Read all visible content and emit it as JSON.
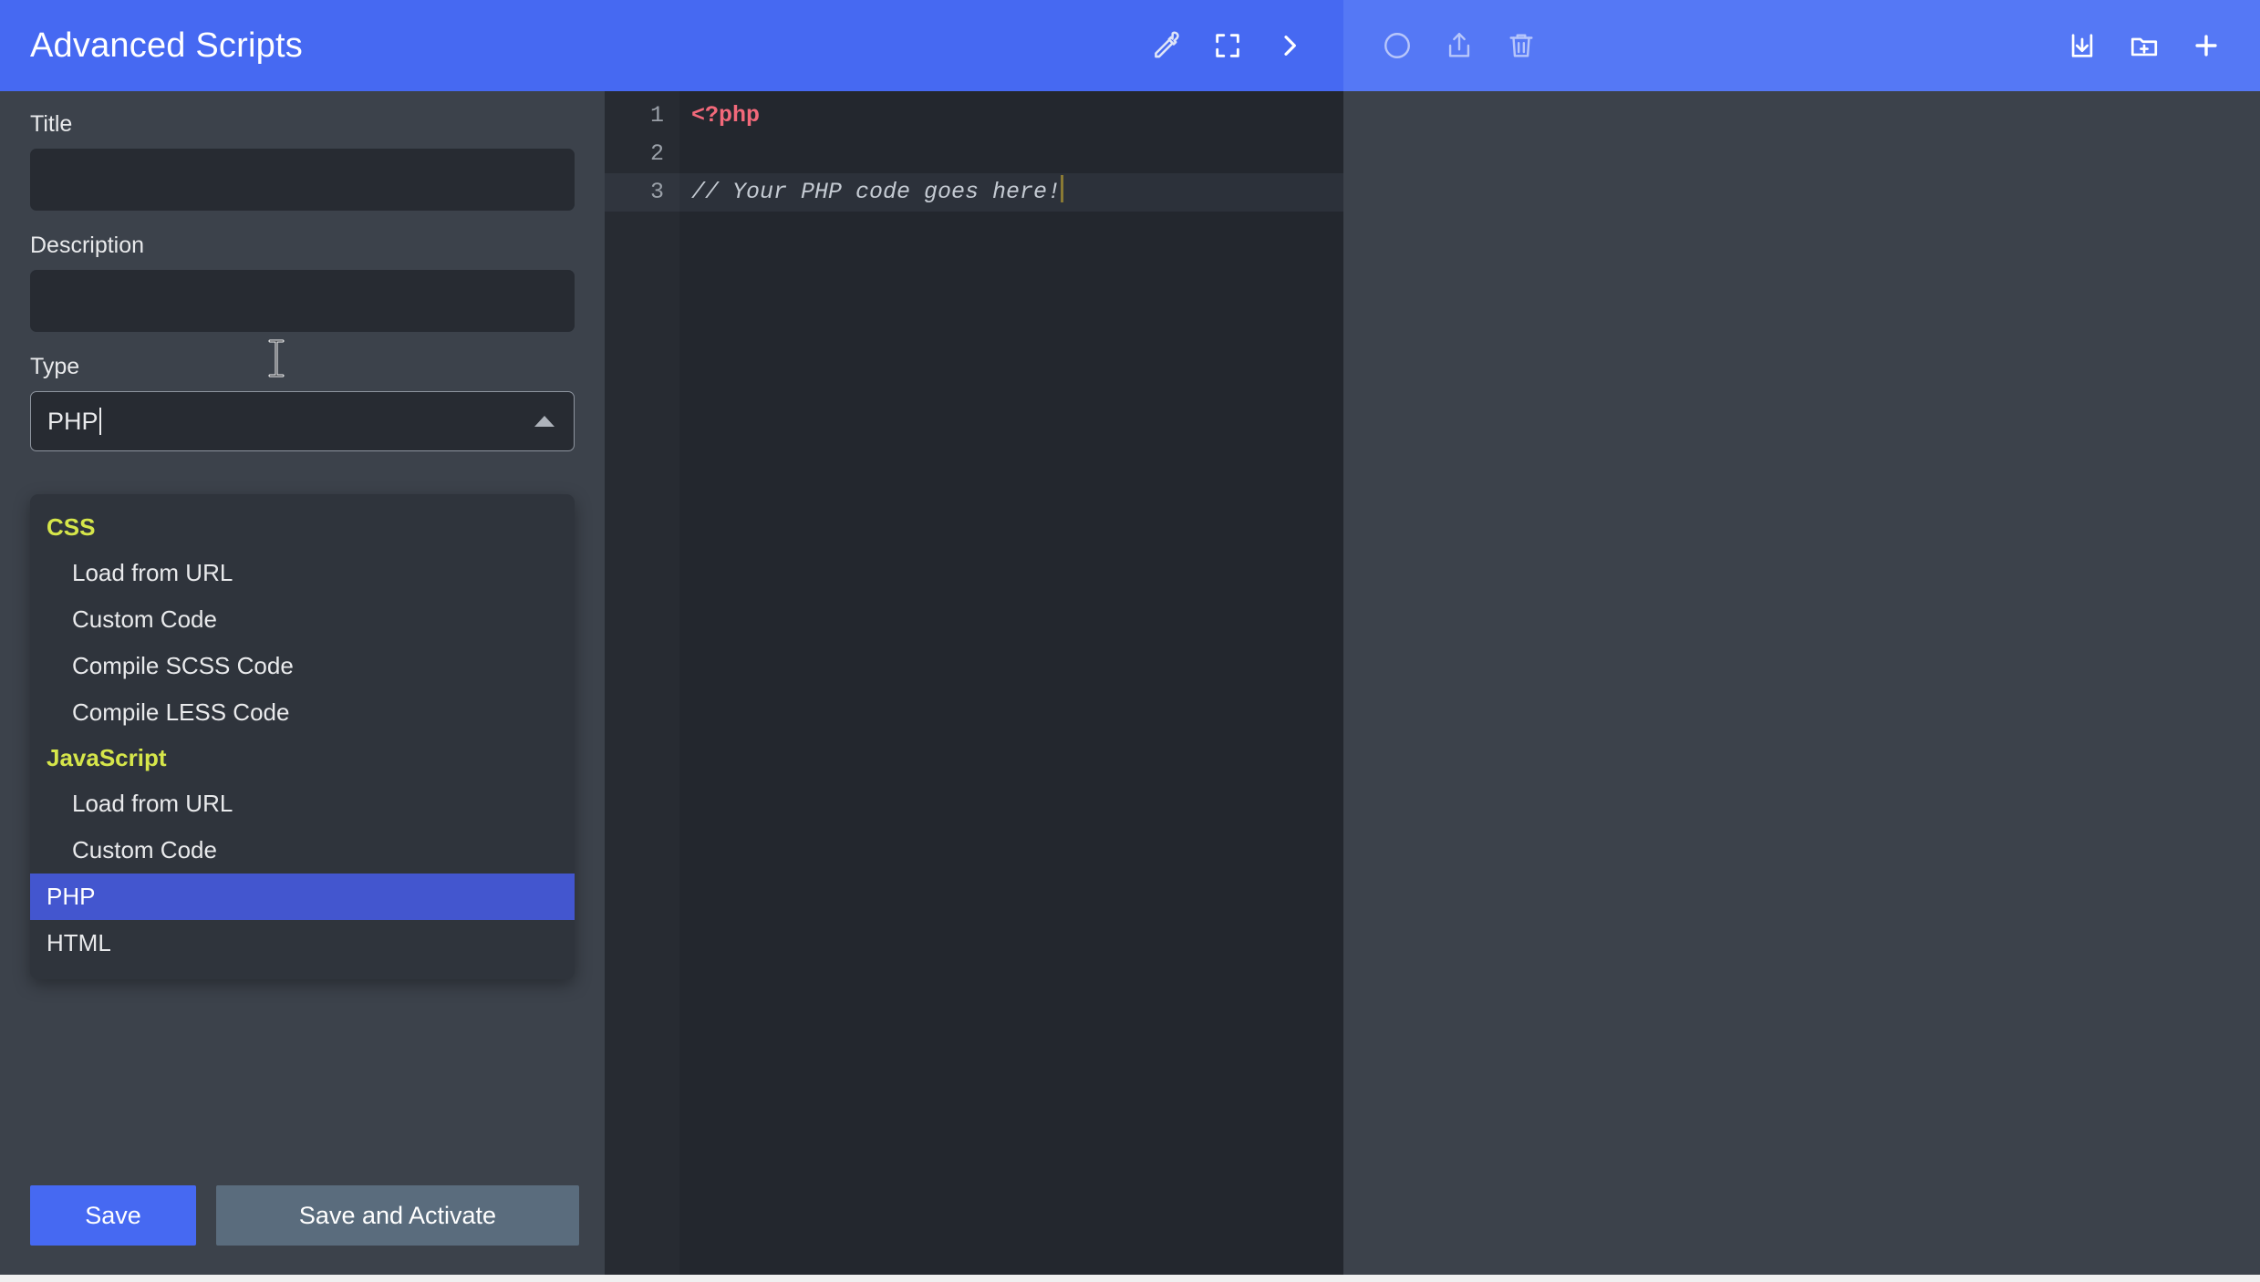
{
  "header": {
    "title": "Advanced Scripts",
    "left_icons": [
      {
        "name": "eyedropper-icon",
        "label": "Color Picker"
      },
      {
        "name": "fullscreen-icon",
        "label": "Fullscreen"
      },
      {
        "name": "chevron-right-icon",
        "label": "Next"
      }
    ],
    "right_icons": [
      {
        "name": "circle-icon",
        "label": "Status"
      },
      {
        "name": "share-upload-icon",
        "label": "Export"
      },
      {
        "name": "trash-icon",
        "label": "Delete"
      }
    ],
    "far_right_icons": [
      {
        "name": "import-download-icon",
        "label": "Import"
      },
      {
        "name": "new-folder-icon",
        "label": "New Folder"
      },
      {
        "name": "plus-icon",
        "label": "New Script"
      }
    ],
    "accent_blue": "#4669f2",
    "accent_blue_light": "#5578f5"
  },
  "form": {
    "title_label": "Title",
    "title_value": "",
    "title_placeholder": "",
    "description_label": "Description",
    "description_value": "",
    "description_placeholder": "",
    "type_label": "Type",
    "type_value": "PHP",
    "type_placeholder": ""
  },
  "dropdown": {
    "open": true,
    "selected": "PHP",
    "group_color": "#d6e64a",
    "highlight_color": "#4356cf",
    "entries": [
      {
        "kind": "group",
        "label": "CSS"
      },
      {
        "kind": "item",
        "label": "Load from URL",
        "indent": true,
        "selected": false
      },
      {
        "kind": "item",
        "label": "Custom Code",
        "indent": true,
        "selected": false
      },
      {
        "kind": "item",
        "label": "Compile SCSS Code",
        "indent": true,
        "selected": false
      },
      {
        "kind": "item",
        "label": "Compile LESS Code",
        "indent": true,
        "selected": false
      },
      {
        "kind": "group",
        "label": "JavaScript"
      },
      {
        "kind": "item",
        "label": "Load from URL",
        "indent": true,
        "selected": false
      },
      {
        "kind": "item",
        "label": "Custom Code",
        "indent": true,
        "selected": false
      },
      {
        "kind": "item",
        "label": "PHP",
        "indent": false,
        "selected": true
      },
      {
        "kind": "item",
        "label": "HTML",
        "indent": false,
        "selected": false
      }
    ]
  },
  "footer": {
    "save_label": "Save",
    "save_activate_label": "Save and Activate"
  },
  "editor": {
    "active_line": 3,
    "lines": [
      {
        "number": "1",
        "tokens": [
          {
            "text": "<?php",
            "type": "php-tag"
          }
        ]
      },
      {
        "number": "2",
        "tokens": []
      },
      {
        "number": "3",
        "tokens": [
          {
            "text": "// Your PHP code goes here!",
            "type": "comment"
          }
        ]
      }
    ],
    "php_tag_color": "#f2697a",
    "comment_color": "#c4cad2"
  }
}
